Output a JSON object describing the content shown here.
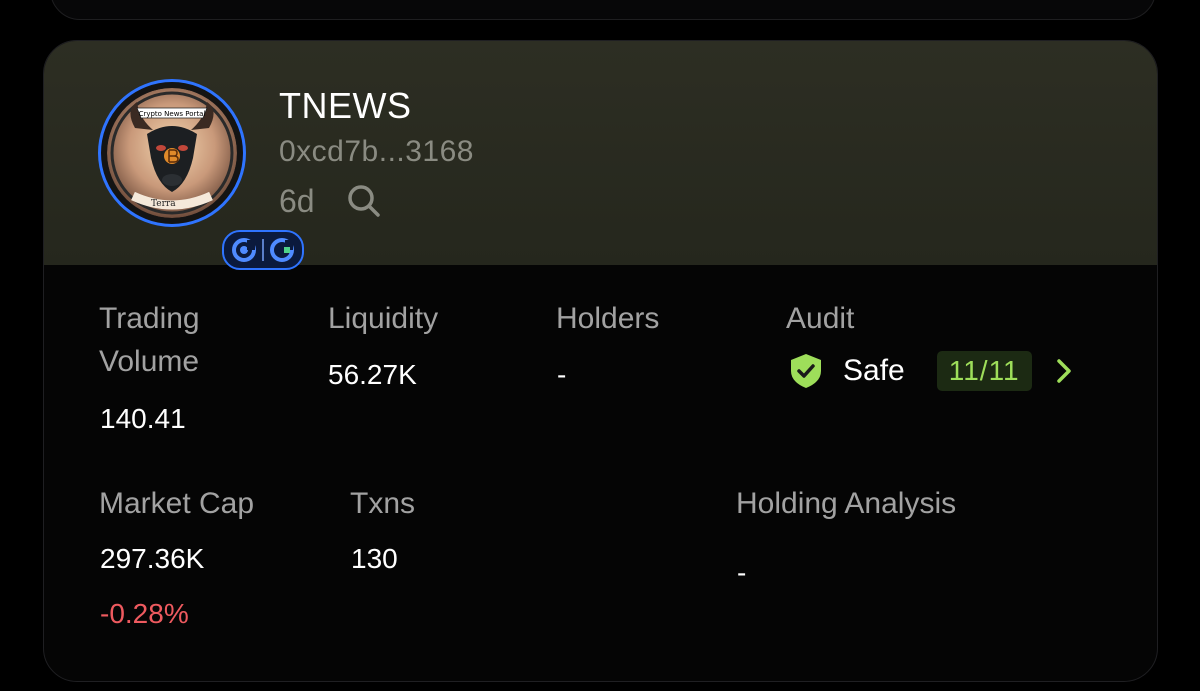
{
  "token": {
    "name": "TNEWS",
    "address": "0xcd7b...3168",
    "age": "6d",
    "logo_text": {
      "top": "Crypto News Portal",
      "bottom": "Terra"
    }
  },
  "stats": {
    "trading_volume": {
      "label_line1": "Trading",
      "label_line2": "Volume",
      "value": "140.41"
    },
    "liquidity": {
      "label": "Liquidity",
      "value": "56.27K"
    },
    "holders": {
      "label": "Holders",
      "value": "-"
    },
    "audit": {
      "label": "Audit",
      "status": "Safe",
      "score": "11/11"
    },
    "market_cap": {
      "label": "Market Cap",
      "value": "297.36K",
      "change": "-0.28%"
    },
    "txns": {
      "label": "Txns",
      "value": "130"
    },
    "holding_analysis": {
      "label": "Holding Analysis",
      "value": "-"
    }
  },
  "colors": {
    "accent_blue": "#2f74ff",
    "safe_green": "#9ede5a",
    "negative_red": "#ee5a5f"
  },
  "icons": [
    "search-icon",
    "shield-check-icon",
    "chevron-right-icon",
    "chain-icon"
  ]
}
